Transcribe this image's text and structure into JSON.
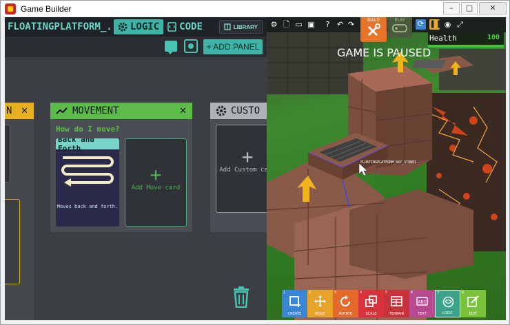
{
  "window": {
    "title": "Game Builder",
    "controls": {
      "minimize": "–",
      "maximize": "□",
      "close": "✕"
    }
  },
  "logic": {
    "tab_name": "FLOATINGPLATFORM_...",
    "tab_logic": "LOGIC",
    "tab_code": "CODE",
    "library": "LIBRARY",
    "add_panel": "+ ADD PANEL",
    "partial_panel_title": "N",
    "movement_panel": {
      "title": "MOVEMENT",
      "question": "How do I move?",
      "card_title": "Back and Forth",
      "card_desc": "Moves back and forth.",
      "add_card": "Add Move card"
    },
    "custom_panel": {
      "title": "CUSTO",
      "add_card": "Add Custom card"
    }
  },
  "game": {
    "build_label": "BUILD",
    "play_label": "PLAY",
    "health_label": "Health",
    "health_value": "100",
    "health_fraction": 1.0,
    "paused_text": "GAME IS PAUSED",
    "object_label": "FLOATINGPLATFORM_SKY_STONE1",
    "tools": [
      {
        "num": "1",
        "label": "CREATE",
        "color": "#3a86d4",
        "icon": "create-icon"
      },
      {
        "num": "2",
        "label": "MOVE",
        "color": "#e8a32a",
        "icon": "move-icon"
      },
      {
        "num": "3",
        "label": "ROTATE",
        "color": "#e36a2a",
        "icon": "rotate-icon"
      },
      {
        "num": "4",
        "label": "SCALE",
        "color": "#d8323a",
        "icon": "scale-icon"
      },
      {
        "num": "5",
        "label": "TERRAIN",
        "color": "#c8323a",
        "icon": "terrain-icon"
      },
      {
        "num": "6",
        "label": "TEXT",
        "color": "#b84a90",
        "icon": "text-icon"
      },
      {
        "num": "7",
        "label": "LOGIC",
        "color": "#3aa38a",
        "icon": "logic-icon"
      },
      {
        "num": "8",
        "label": "EDIT",
        "color": "#7ac23a",
        "icon": "edit-icon"
      }
    ]
  },
  "colors": {
    "accent": "#3fb4a6",
    "movement_green": "#5dbb4a",
    "partial_yellow": "#e8b020",
    "build_orange": "#e8742a"
  }
}
